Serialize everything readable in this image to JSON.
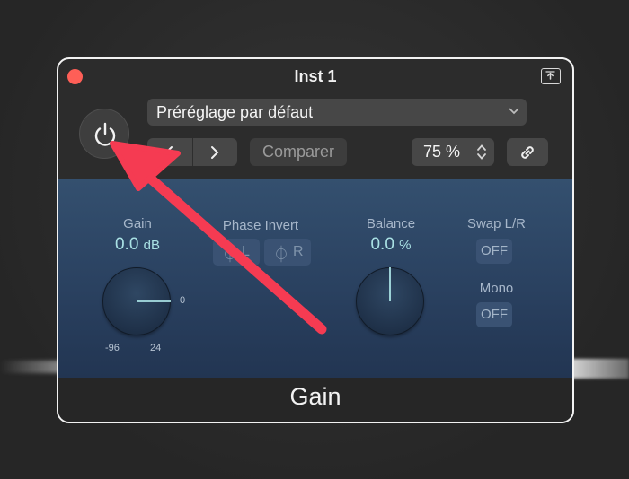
{
  "window": {
    "title": "Inst 1"
  },
  "header": {
    "preset": "Préréglage par défaut",
    "compare_label": "Comparer",
    "zoom": "75 %"
  },
  "plugin": {
    "gain": {
      "label": "Gain",
      "value": "0.0",
      "unit": "dB",
      "tick_min": "-96",
      "tick_max": "24",
      "tick_zero": "0"
    },
    "phase_invert": {
      "label": "Phase Invert",
      "left": "L",
      "right": "R"
    },
    "balance": {
      "label": "Balance",
      "value": "0.0",
      "unit": "%"
    },
    "swap": {
      "label": "Swap L/R",
      "state": "OFF"
    },
    "mono": {
      "label": "Mono",
      "state": "OFF"
    },
    "name": "Gain"
  },
  "colors": {
    "accent_value": "#a9e1e4",
    "panel": "#2a4160",
    "arrow": "#f53b52",
    "close": "#fe5f57"
  },
  "icons": [
    "close-icon",
    "expand-icon",
    "power-icon",
    "chevron-down-icon",
    "chevron-left-icon",
    "chevron-right-icon",
    "stepper-icon",
    "link-icon",
    "phase-icon"
  ]
}
